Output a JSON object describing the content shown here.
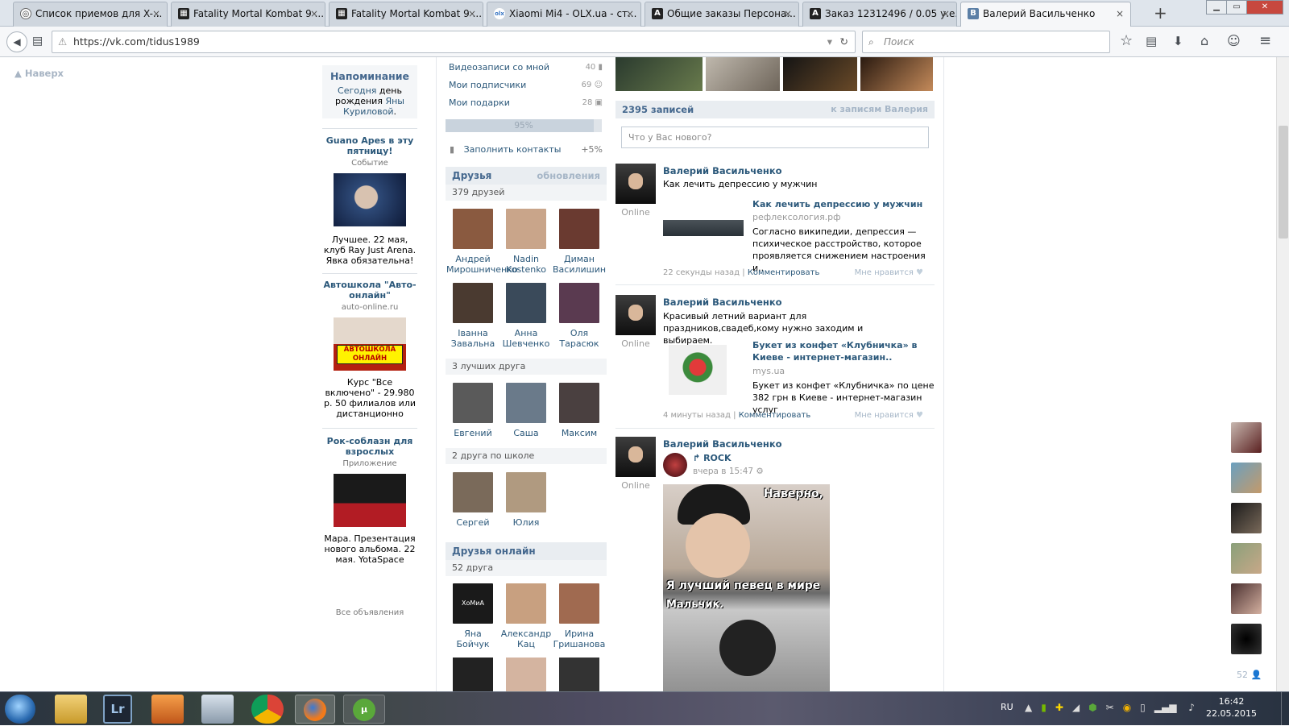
{
  "browser": {
    "tabs": [
      {
        "label": "Список приемов для X-...",
        "icon": "globe-icon"
      },
      {
        "label": "Fatality Mortal Kombat 9 ...",
        "icon": "game-icon"
      },
      {
        "label": "Fatality Mortal Kombat 9 ...",
        "icon": "game-icon"
      },
      {
        "label": "Xiaomi Mi4 - OLX.ua - ст...",
        "icon": "olx-icon"
      },
      {
        "label": "Общие заказы Персона...",
        "icon": "a-icon"
      },
      {
        "label": "Заказ 12312496 / 0.05 у.е...",
        "icon": "a-icon"
      },
      {
        "label": "Валерий Васильченко",
        "icon": "vk-icon",
        "active": true
      }
    ],
    "url": "https://vk.com/tidus1989",
    "search_placeholder": "Поиск",
    "tab_close": "×",
    "new_tab": "+",
    "window_buttons": [
      "▁",
      "▭",
      "✕"
    ],
    "nav_glyphs": {
      "back": "◀",
      "reader": "▤",
      "reload": "↻",
      "dropdown": "▾",
      "search": "⌕"
    },
    "toolbar_glyphs": [
      "☆",
      "▤",
      "⬇",
      "⌂",
      "☺",
      "≡"
    ],
    "icon_letters": {
      "vk": "В",
      "a": "A",
      "olx": "olx",
      "game": "▦",
      "globe": "◎"
    }
  },
  "page": {
    "up_link": "Наверх",
    "reminder": {
      "title": "Напоминание",
      "text_a": "Сегодня",
      "text_b": "день рождения",
      "text_c": "Яны Куриловой",
      "text_d": "."
    },
    "ads": [
      {
        "title": "Guano Apes в эту пятницу!",
        "sub": "Событие",
        "text": "Лучшее. 22 мая, клуб Ray Just Arena. Явка обязательна!"
      },
      {
        "title": "Автошкола \"Авто-онлайн\"",
        "sub": "auto-online.ru",
        "text": "Курс \"Все включено\" - 29.980 р. 50 филиалов или дистанционно",
        "img_text": "АВТОШКОЛА ОНЛАЙН"
      },
      {
        "title": "Рок-соблазн для взрослых",
        "sub": "Приложение",
        "text": "Мара. Презентация нового альбома. 22 мая. YotaSpace"
      }
    ],
    "all_ads": "Все объявления",
    "profile_links": [
      {
        "label": "Видеозаписи со мной",
        "count": "40",
        "icon": "video-icon"
      },
      {
        "label": "Мои подписчики",
        "count": "69",
        "icon": "people-icon"
      },
      {
        "label": "Мои подарки",
        "count": "28",
        "icon": "gift-icon"
      }
    ],
    "progress": {
      "label": "95%",
      "value": 0.95
    },
    "fill_contacts": {
      "label": "Заполнить контакты",
      "bonus": "+5%"
    },
    "friends": {
      "title": "Друзья",
      "updates": "обновления",
      "count": "379 друзей",
      "list": [
        {
          "name": "Андрей Мирошниченко",
          "color": "#8a5a40"
        },
        {
          "name": "Nadin Kostenko",
          "color": "#c9a58a"
        },
        {
          "name": "Диман Василишин",
          "color": "#6a3a30"
        },
        {
          "name": "Іванна Завальна",
          "color": "#4a3a30"
        },
        {
          "name": "Анна Шевченко",
          "color": "#3a4a5a"
        },
        {
          "name": "Оля Тарасюк",
          "color": "#5a3a50"
        }
      ],
      "best_title": "3 лучших друга",
      "best": [
        {
          "name": "Евгений",
          "color": "#5a5a5a"
        },
        {
          "name": "Саша",
          "color": "#6a7a8a"
        },
        {
          "name": "Максим",
          "color": "#4a4040"
        }
      ],
      "school_title": "2 друга по школе",
      "school": [
        {
          "name": "Сергей",
          "color": "#7a6a5a"
        },
        {
          "name": "Юлия",
          "color": "#b09a80"
        }
      ]
    },
    "friends_online": {
      "title": "Друзья онлайн",
      "count": "52 друга",
      "list": [
        {
          "name": "Яна Бойчук",
          "color": "#1a1a1a",
          "pic_text": "ХоМиА"
        },
        {
          "name": "Александр Кац",
          "color": "#c8a080"
        },
        {
          "name": "Ирина Гришанова",
          "color": "#a06a50"
        }
      ]
    },
    "wall": {
      "count": "2395 записей",
      "to_posts": "к записям Валерия",
      "placeholder": "Что у Вас нового?",
      "posts": [
        {
          "author": "Валерий Васильченко",
          "status": "Online",
          "text": "Как лечить депрессию у мужчин",
          "link_title": "Как лечить депрессию у мужчин",
          "link_domain": "рефлексология.рф",
          "link_desc": "Согласно википедии, депрессия — психическое расстройство, которое проявляется снижением настроения и..",
          "time": "22 секунды назад",
          "comment": "Комментировать",
          "like": "Мне нравится"
        },
        {
          "author": "Валерий Васильченко",
          "status": "Online",
          "text": "Красивый летний вариант для праздников,свадеб,кому нужно заходим и выбираем.",
          "link_title": "Букет из конфет «Клубничка» в Киеве - интернет-магазин..",
          "link_domain": "mys.ua",
          "link_desc": "Букет из конфет «Клубничка» по цене 382 грн в Киеве - интернет-магазин услуг",
          "time": "4 минуты назад",
          "comment": "Комментировать",
          "like": "Мне нравится"
        },
        {
          "author": "Валерий Васильченко",
          "status": "Online",
          "repost_group": "ROCK",
          "repost_time": "вчера в 15:47",
          "meme_top": "Наверно,",
          "meme_mid": "Я лучший певец в мире",
          "meme_bot": "Мальчик."
        }
      ]
    },
    "online_sidebar": {
      "count": "52"
    }
  },
  "taskbar": {
    "lang": "RU",
    "time": "16:42",
    "date": "22.05.2015",
    "apps": [
      "start",
      "explorer",
      "lightroom",
      "media-player",
      "calculator",
      "chrome",
      "firefox",
      "utorrent"
    ],
    "app_labels": {
      "lightroom": "Lr",
      "utorrent": "µ"
    },
    "tray_glyphs": [
      "▲",
      "▮",
      "✚",
      "◢",
      "⬢",
      "✂",
      "◉",
      "▯",
      "▂▄▆",
      "♪"
    ]
  },
  "colors": {
    "vk_blue": "#2b587a",
    "header_blue": "#45688e",
    "header_bg": "#e9edf1",
    "muted": "#a6b6c7"
  }
}
